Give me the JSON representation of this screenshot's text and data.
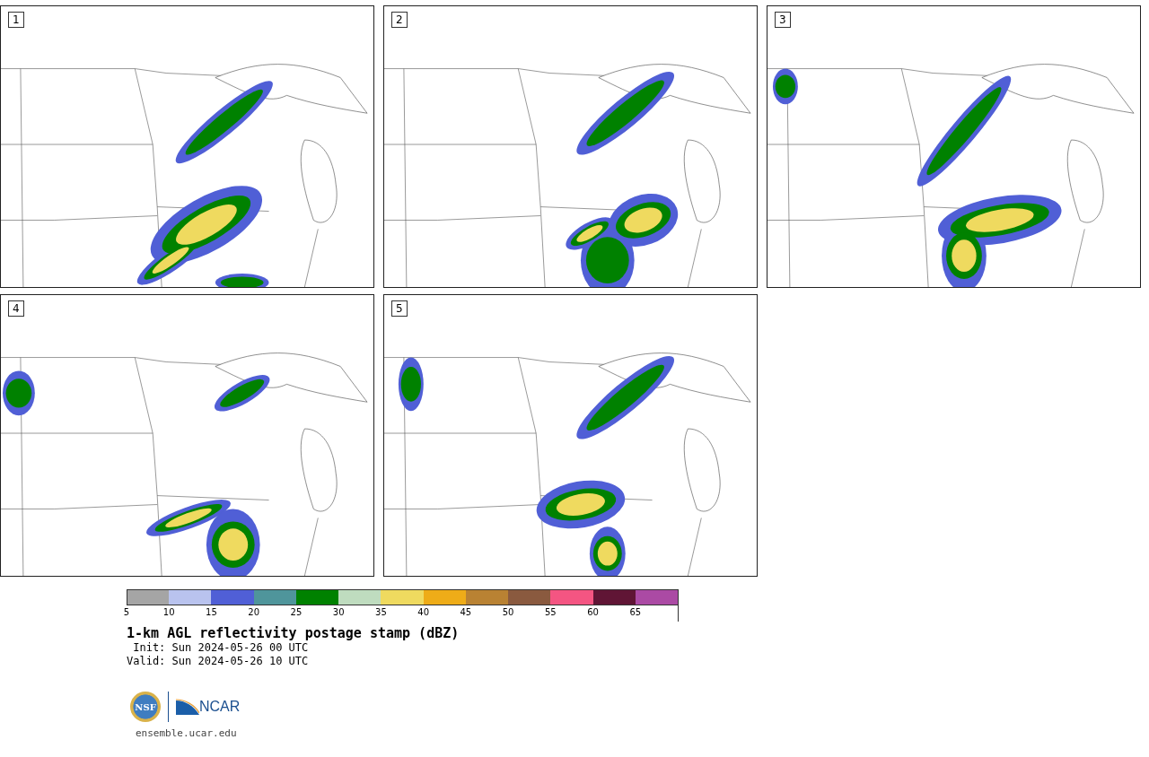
{
  "panels": [
    {
      "label": "1"
    },
    {
      "label": "2"
    },
    {
      "label": "3"
    },
    {
      "label": "4"
    },
    {
      "label": "5"
    }
  ],
  "colorbar": {
    "segments": [
      {
        "tick": "5",
        "color": "#a5a5a5"
      },
      {
        "tick": "10",
        "color": "#b9c3ee"
      },
      {
        "tick": "15",
        "color": "#505fd6"
      },
      {
        "tick": "20",
        "color": "#4f959b"
      },
      {
        "tick": "25",
        "color": "#008100"
      },
      {
        "tick": "30",
        "color": "#bfdcbf"
      },
      {
        "tick": "35",
        "color": "#efda5f"
      },
      {
        "tick": "40",
        "color": "#eeac18"
      },
      {
        "tick": "45",
        "color": "#b98233"
      },
      {
        "tick": "50",
        "color": "#8a5a3f"
      },
      {
        "tick": "55",
        "color": "#f45582"
      },
      {
        "tick": "60",
        "color": "#601535"
      },
      {
        "tick": "65",
        "color": "#ab4aa4"
      }
    ]
  },
  "title": "1-km AGL reflectivity postage stamp (dBZ)",
  "init": " Init: Sun 2024-05-26 00 UTC",
  "valid": "Valid: Sun 2024-05-26 10 UTC",
  "logo": {
    "nsf": "NSF",
    "ncar": "NCAR"
  },
  "site": "ensemble.ucar.edu"
}
